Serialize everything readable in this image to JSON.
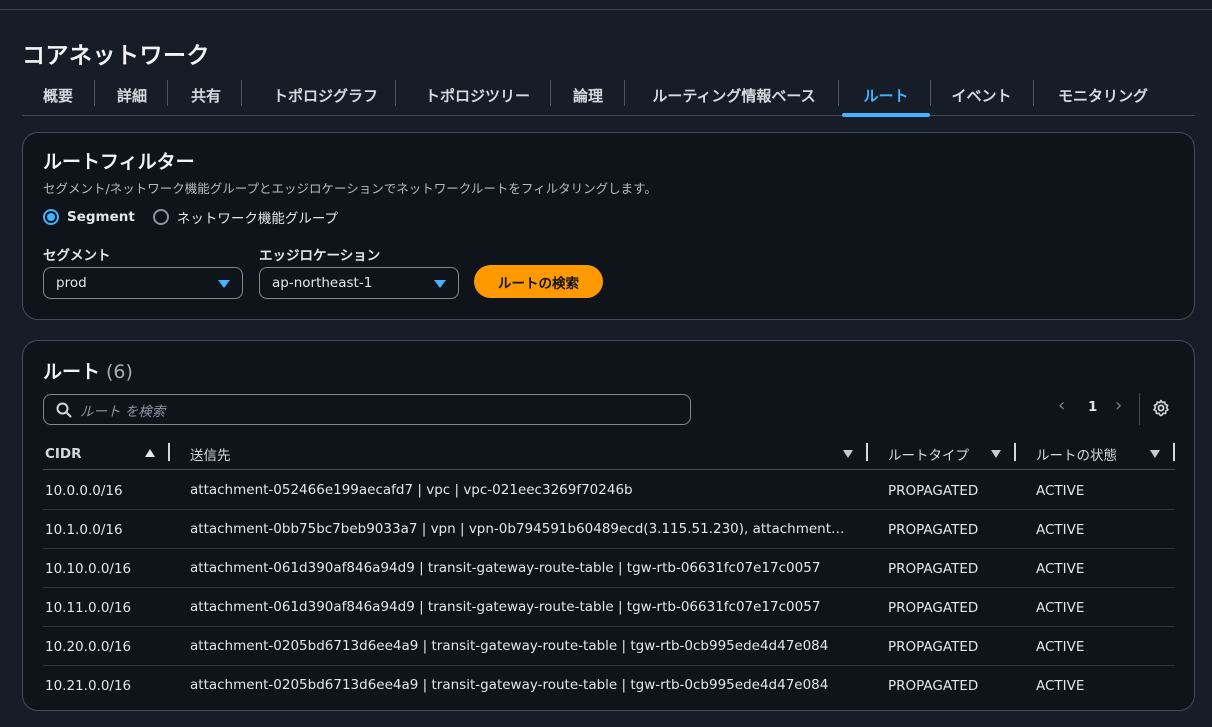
{
  "page": {
    "title": "コアネットワーク"
  },
  "tabs": [
    {
      "label": "概要"
    },
    {
      "label": "詳細"
    },
    {
      "label": "共有"
    },
    {
      "label": "トポロジグラフ"
    },
    {
      "label": "トポロジツリー"
    },
    {
      "label": "論理"
    },
    {
      "label": "ルーティング情報ベース"
    },
    {
      "label": "ルート"
    },
    {
      "label": "イベント"
    },
    {
      "label": "モニタリング"
    }
  ],
  "active_tab": "ルート",
  "filter": {
    "title": "ルートフィルター",
    "description": "セグメント/ネットワーク機能グループとエッジロケーションでネットワークルートをフィルタリングします。",
    "radio_segment": "Segment",
    "radio_nfg": "ネットワーク機能グループ",
    "selected_radio": "Segment",
    "segment_label": "セグメント",
    "segment_value": "prod",
    "edge_label": "エッジロケーション",
    "edge_value": "ap-northeast-1",
    "search_button": "ルートの検索"
  },
  "routes": {
    "title": "ルート",
    "count": "(6)",
    "search_placeholder": "ルート を検索",
    "page": "1",
    "columns": {
      "cidr": "CIDR",
      "dest": "送信先",
      "type": "ルートタイプ",
      "state": "ルートの状態"
    },
    "rows": [
      {
        "cidr": "10.0.0.0/16",
        "dest": "attachment-052466e199aecafd7 | vpc | vpc-021eec3269f70246b",
        "type": "PROPAGATED",
        "state": "ACTIVE"
      },
      {
        "cidr": "10.1.0.0/16",
        "dest": "attachment-0bb75bc7beb9033a7 | vpn | vpn-0b794591b60489ecd(3.115.51.230), attachment-0bb7...",
        "type": "PROPAGATED",
        "state": "ACTIVE"
      },
      {
        "cidr": "10.10.0.0/16",
        "dest": "attachment-061d390af846a94d9 | transit-gateway-route-table | tgw-rtb-06631fc07e17c0057",
        "type": "PROPAGATED",
        "state": "ACTIVE"
      },
      {
        "cidr": "10.11.0.0/16",
        "dest": "attachment-061d390af846a94d9 | transit-gateway-route-table | tgw-rtb-06631fc07e17c0057",
        "type": "PROPAGATED",
        "state": "ACTIVE"
      },
      {
        "cidr": "10.20.0.0/16",
        "dest": "attachment-0205bd6713d6ee4a9 | transit-gateway-route-table | tgw-rtb-0cb995ede4d47e084",
        "type": "PROPAGATED",
        "state": "ACTIVE"
      },
      {
        "cidr": "10.21.0.0/16",
        "dest": "attachment-0205bd6713d6ee4a9 | transit-gateway-route-table | tgw-rtb-0cb995ede4d47e084",
        "type": "PROPAGATED",
        "state": "ACTIVE"
      }
    ]
  },
  "colors": {
    "accent": "#42b4ff",
    "primary_button": "#ff9900",
    "background": "#161d26",
    "panel": "#0f141a"
  },
  "icons": {
    "search": "search-icon",
    "settings": "gear-icon",
    "prev": "chevron-left-icon",
    "next": "chevron-right-icon"
  }
}
